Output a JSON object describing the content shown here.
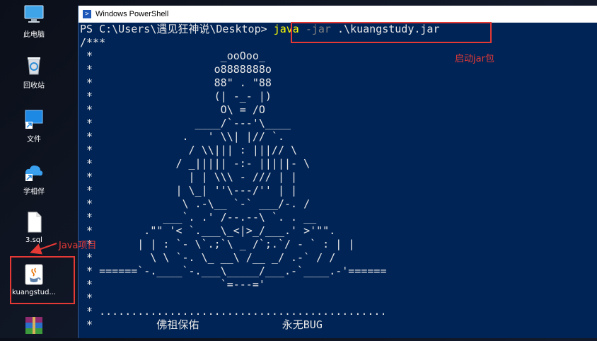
{
  "desktop": {
    "icons": [
      {
        "label": "此电脑",
        "icon": "computer-icon"
      },
      {
        "label": "回收站",
        "icon": "recycle-bin-icon"
      },
      {
        "label": "文件",
        "icon": "file-shortcut-icon"
      },
      {
        "label": "学相伴",
        "icon": "cloud-shortcut-icon"
      },
      {
        "label": "3.sql",
        "icon": "sql-file-icon"
      },
      {
        "label": "kuangstud...",
        "icon": "java-jar-icon"
      },
      {
        "label": "",
        "icon": "winrar-icon"
      }
    ]
  },
  "window": {
    "title": "Windows PowerShell"
  },
  "console": {
    "prompt": "PS C:\\Users\\遇见狂神说\\Desktop> ",
    "cmd_java": "java",
    "cmd_param": " -jar",
    "cmd_arg": " .\\kuangstudy.jar",
    "banner_lines": [
      "/***",
      " *                    _ooOoo_",
      " *                   o8888888o",
      " *                   88\" . \"88",
      " *                   (| -_- |)",
      " *                    O\\ = /O",
      " *                ____/`---'\\____",
      " *              .   ' \\\\| |// `.",
      " *               / \\\\||| : |||// \\",
      " *             / _||||| -:- |||||- \\",
      " *               | | \\\\\\ - /// | |",
      " *             | \\_| ''\\---/'' | |",
      " *              \\ .-\\__ `-` ___/-. /",
      " *           ___`. .' /--.--\\ `. . __",
      " *        .\"\" '< `.___\\_<|>_/___.' >'\"\".",
      " *       | | : `- \\`.;`\\ _ /`;.`/ - ` : | |",
      " *         \\ \\ `-. \\_ __\\ /__ _/ .-` / /",
      " * ======`-.____`-.___\\_____/___.-`____.-'======",
      " *                    `=---='",
      " *",
      " * .............................................",
      " *          佛祖保佑             永无BUG"
    ]
  },
  "annotations": {
    "run_jar": "启动jar包",
    "java_project": "Java项目"
  },
  "colors": {
    "console_bg": "#012456",
    "annotation_red": "#e53935",
    "cmd_yellow": "#ffff00"
  }
}
